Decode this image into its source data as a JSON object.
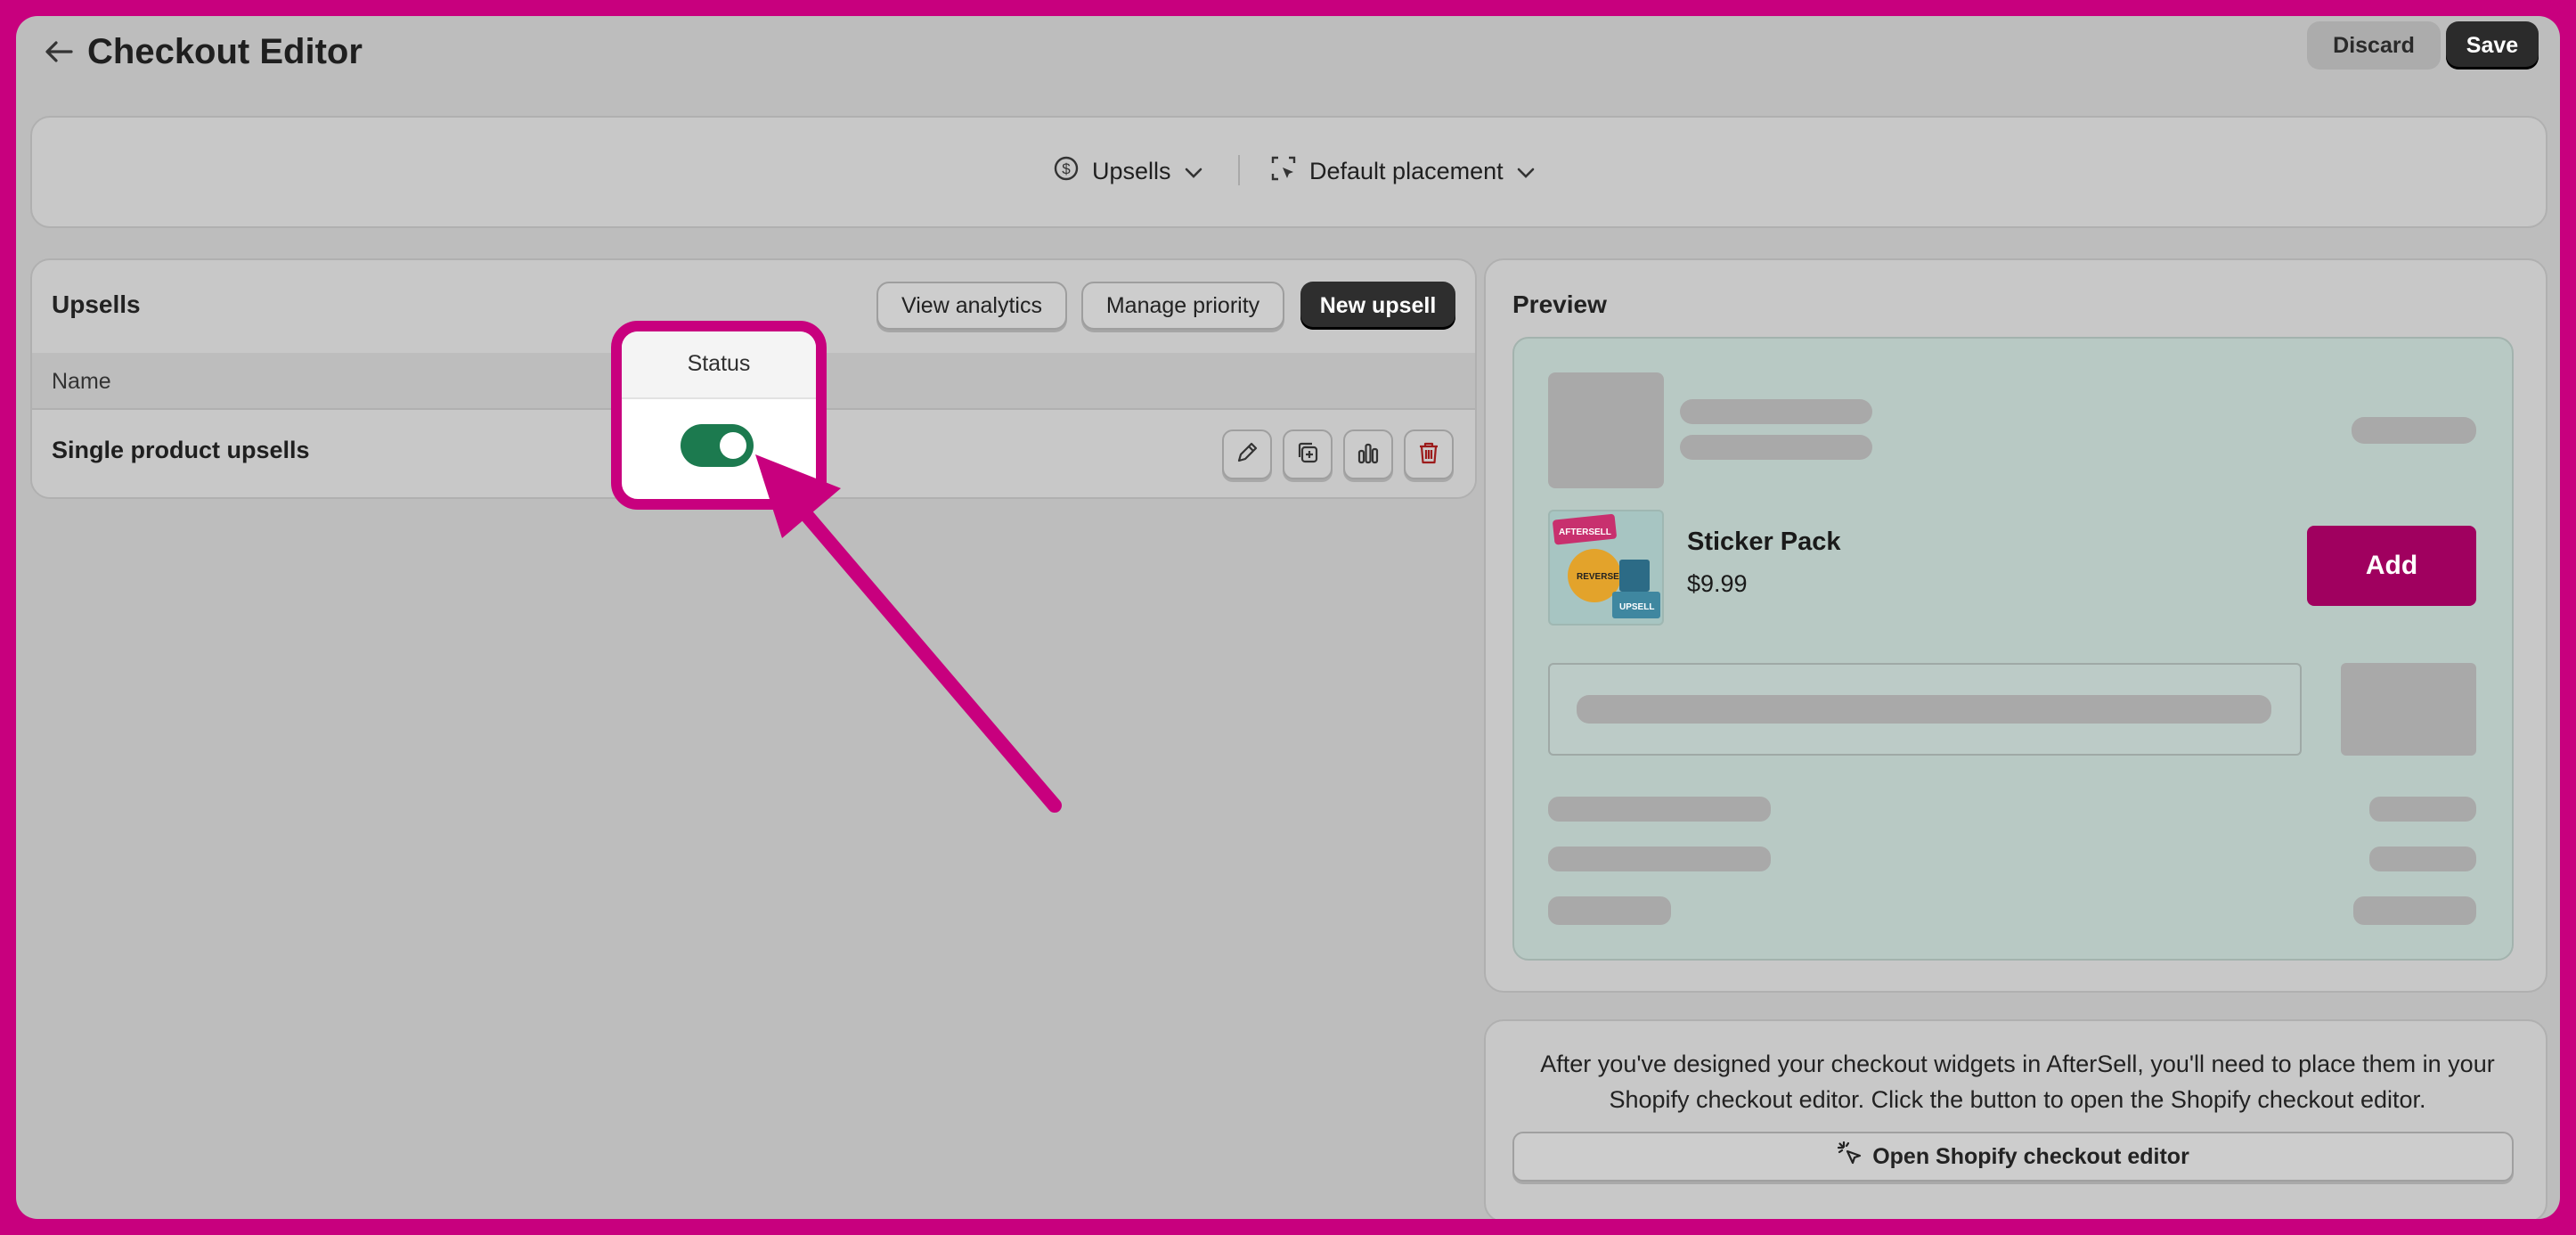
{
  "header": {
    "title": "Checkout Editor",
    "discard_label": "Discard",
    "save_label": "Save"
  },
  "selectors": {
    "offer_type": "Upsells",
    "placement": "Default placement"
  },
  "upsells": {
    "title": "Upsells",
    "view_analytics_label": "View analytics",
    "manage_priority_label": "Manage priority",
    "new_upsell_label": "New upsell",
    "columns": [
      "Name",
      "Status"
    ],
    "rows": [
      {
        "name": "Single product upsells",
        "status": "on"
      }
    ]
  },
  "preview": {
    "title": "Preview",
    "product_name": "Sticker Pack",
    "product_price": "$9.99",
    "add_label": "Add",
    "thumbnail_text": [
      "AFTERSELL",
      "REVERSE",
      "UPSELL"
    ]
  },
  "info": {
    "text": "After you've designed your checkout widgets in AfterSell, you'll need to place them in your Shopify checkout editor. Click the button to open the Shopify checkout editor.",
    "open_button_label": "Open Shopify checkout editor"
  },
  "colors": {
    "annotation": "#c8007e",
    "toggle_on": "#1c7a4f",
    "add_button": "#a0005f"
  }
}
